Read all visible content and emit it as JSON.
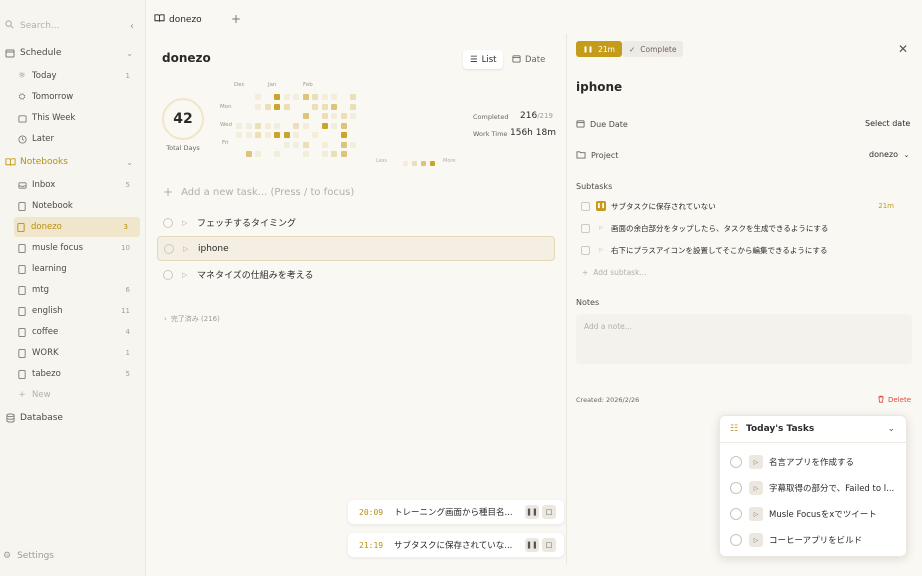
{
  "sidebar": {
    "search_placeholder": "Search...",
    "schedule": {
      "label": "Schedule",
      "items": [
        {
          "label": "Today",
          "count": "1"
        },
        {
          "label": "Tomorrow",
          "count": ""
        },
        {
          "label": "This Week",
          "count": ""
        },
        {
          "label": "Later",
          "count": ""
        }
      ]
    },
    "notebooks": {
      "label": "Notebooks",
      "items": [
        {
          "label": "Inbox",
          "count": "5"
        },
        {
          "label": "Notebook",
          "count": ""
        },
        {
          "label": "donezo",
          "count": "3"
        },
        {
          "label": "musle focus",
          "count": "10"
        },
        {
          "label": "learning",
          "count": ""
        },
        {
          "label": "mtg",
          "count": "6"
        },
        {
          "label": "english",
          "count": "11"
        },
        {
          "label": "coffee",
          "count": "4"
        },
        {
          "label": "WORK",
          "count": "1"
        },
        {
          "label": "tabezo",
          "count": "5"
        }
      ],
      "new_label": "New"
    },
    "database_label": "Database",
    "settings_label": "Settings"
  },
  "tabbar": {
    "tab_label": "donezo"
  },
  "main": {
    "title": "donezo",
    "view_list": "List",
    "view_date": "Date",
    "total_days": "42",
    "total_days_label": "Total Days",
    "heatmap": {
      "months": [
        "Dec",
        "Jan",
        "Feb"
      ],
      "days": [
        "Mon",
        "Wed",
        "Fri"
      ],
      "legend_less": "Less",
      "legend_more": "More"
    },
    "completed_label": "Completed",
    "completed_value": "216",
    "completed_total": "/219",
    "worktime_label": "Work Time",
    "worktime_value": "156h 18m",
    "add_task_placeholder": "Add a new task... (Press / to focus)",
    "tasks": [
      {
        "title": "フェッチするタイミング"
      },
      {
        "title": "iphone"
      },
      {
        "title": "マネタイズの仕組みを考える"
      }
    ],
    "done_toggle": "完了済み (216)"
  },
  "timers": [
    {
      "time": "20:09",
      "title": "トレーニング画面から種目名..."
    },
    {
      "time": "21:19",
      "title": "サブタスクに保存されていな..."
    }
  ],
  "detail": {
    "timer_badge": "21m",
    "complete_label": "Complete",
    "title": "iphone",
    "due_date_label": "Due Date",
    "due_date_value": "Select date",
    "project_label": "Project",
    "project_value": "donezo",
    "subtasks_label": "Subtasks",
    "subtasks": [
      {
        "title": "サブタスクに保存されていない",
        "duration": "21m"
      },
      {
        "title": "画面の余白部分をタップしたら、タスクを生成できるようにする",
        "duration": ""
      },
      {
        "title": "右下にプラスアイコンを設置してそこから編集できるようにする",
        "duration": ""
      }
    ],
    "add_subtask": "Add subtask...",
    "notes_label": "Notes",
    "notes_placeholder": "Add a note...",
    "created": "Created: 2026/2/26",
    "delete_label": "Delete"
  },
  "today_popup": {
    "title": "Today's Tasks",
    "items": [
      {
        "title": "名言アプリを作成する"
      },
      {
        "title": "字幕取得の部分で、Failed to l..."
      },
      {
        "title": "Musle Focusをxでツイート"
      },
      {
        "title": "コーヒーアプリをビルド"
      }
    ]
  },
  "colors": {
    "accent": "#c49b1a",
    "accent_light": "#f0e6cc",
    "danger": "#d94a3a"
  }
}
